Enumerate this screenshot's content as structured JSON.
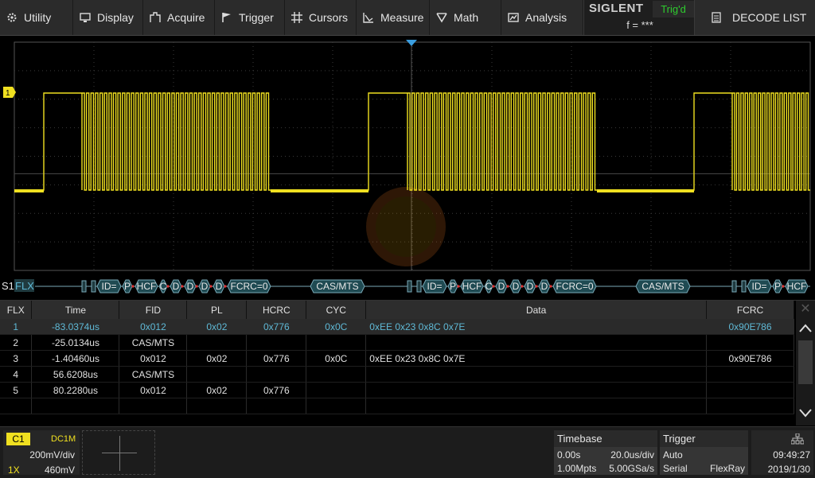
{
  "menu": {
    "utility": "Utility",
    "display": "Display",
    "acquire": "Acquire",
    "trigger": "Trigger",
    "cursors": "Cursors",
    "measure": "Measure",
    "math": "Math",
    "analysis": "Analysis"
  },
  "brand": {
    "logo": "SIGLENT",
    "trig_status": "Trig'd",
    "freq": "f = ***"
  },
  "decode_list": "DECODE LIST",
  "channel_marker": "1",
  "bus": {
    "label_s1": "S1",
    "label_proto": "FLX",
    "frames": [
      [
        "ID=",
        "P",
        "HCF",
        "C",
        "D",
        "D",
        "D",
        "D",
        "FCRC=0",
        "CAS/MTS"
      ],
      [
        "ID=",
        "P",
        "HCF",
        "C",
        "D",
        "D",
        "D",
        "D",
        "FCRC=0",
        "CAS/MTS"
      ],
      [
        "ID=",
        "P",
        "HCF"
      ]
    ]
  },
  "table": {
    "headers": [
      "FLX",
      "Time",
      "FID",
      "PL",
      "HCRC",
      "CYC",
      "Data",
      "FCRC"
    ],
    "rows": [
      [
        "1",
        "-83.0374us",
        "0x012",
        "0x02",
        "0x776",
        "0x0C",
        "0xEE 0x23 0x8C 0x7E",
        "0x90E786"
      ],
      [
        "2",
        "-25.0134us",
        "CAS/MTS",
        "",
        "",
        "",
        "",
        ""
      ],
      [
        "3",
        "-1.40460us",
        "0x012",
        "0x02",
        "0x776",
        "0x0C",
        "0xEE 0x23 0x8C 0x7E",
        "0x90E786"
      ],
      [
        "4",
        "56.6208us",
        "CAS/MTS",
        "",
        "",
        "",
        "",
        ""
      ],
      [
        "5",
        "80.2280us",
        "0x012",
        "0x02",
        "0x776",
        "",
        "",
        ""
      ]
    ],
    "selected_row": 0
  },
  "channel1": {
    "tag": "C1",
    "coupling": "DC1M",
    "vdiv": "200mV/div",
    "probe": "1X",
    "offset": "460mV"
  },
  "timebase": {
    "title": "Timebase",
    "delay": "0.00s",
    "tdiv": "20.0us/div",
    "mem": "1.00Mpts",
    "rate": "5.00GSa/s"
  },
  "trigger": {
    "title": "Trigger",
    "mode": "Auto",
    "type": "Serial",
    "source": "FlexRay"
  },
  "clock": {
    "time": "09:49:27",
    "date": "2019/1/30"
  },
  "colors": {
    "trace": "#f0e020",
    "accent": "#5fb9d6",
    "trig_ok": "#2ecc2e"
  }
}
